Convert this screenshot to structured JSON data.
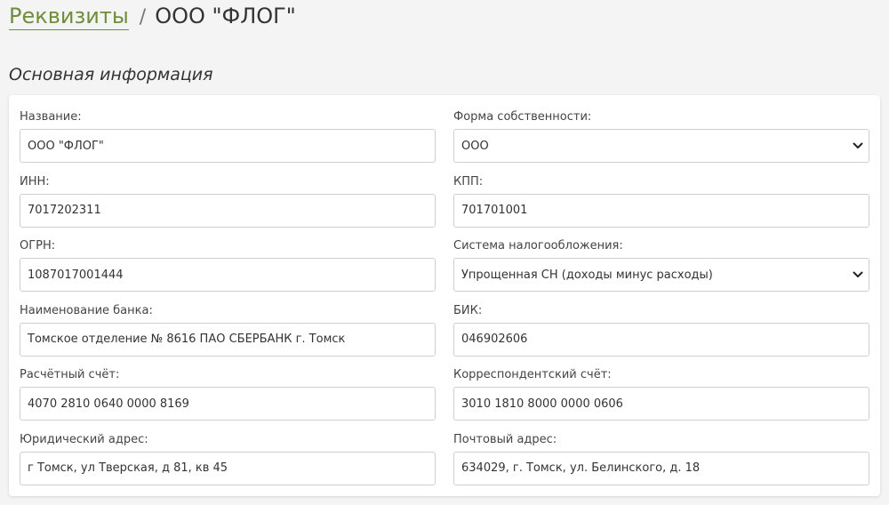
{
  "breadcrumb": {
    "link_label": "Реквизиты",
    "separator": "/",
    "current": "ООО \"ФЛОГ\""
  },
  "section": {
    "title": "Основная информация"
  },
  "colors": {
    "accent": "#6f8e3c"
  },
  "fields": {
    "name": {
      "label": "Название:",
      "value": "ООО \"ФЛОГ\""
    },
    "ownership": {
      "label": "Форма собственности:",
      "value": "ООО"
    },
    "inn": {
      "label": "ИНН:",
      "value": "7017202311"
    },
    "kpp": {
      "label": "КПП:",
      "value": "701701001"
    },
    "ogrn": {
      "label": "ОГРН:",
      "value": "1087017001444"
    },
    "tax_system": {
      "label": "Система налогообложения:",
      "value": "Упрощенная СН (доходы минус расходы)"
    },
    "bank_name": {
      "label": "Наименование банка:",
      "value": "Томское отделение № 8616 ПАО СБЕРБАНК г. Томск"
    },
    "bik": {
      "label": "БИК:",
      "value": "046902606"
    },
    "account": {
      "label": "Расчётный счёт:",
      "value": "4070 2810 0640 0000 8169"
    },
    "corr_account": {
      "label": "Корреспондентский счёт:",
      "value": "3010 1810 8000 0000 0606"
    },
    "legal_address": {
      "label": "Юридический адрес:",
      "value": "г Томск, ул Тверская, д 81, кв 45"
    },
    "postal_address": {
      "label": "Почтовый адрес:",
      "value": "634029, г. Томск, ул. Белинского, д. 18"
    }
  },
  "icons": {
    "select_chevron": "chevron-down-icon"
  }
}
